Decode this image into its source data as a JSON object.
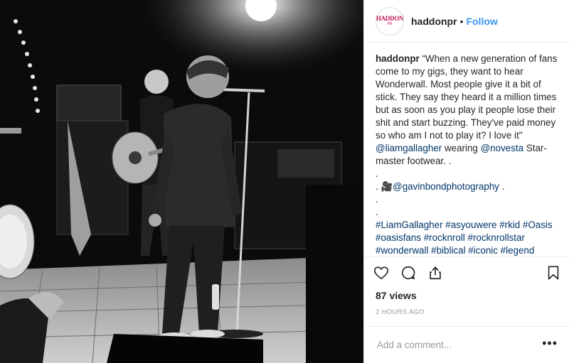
{
  "post": {
    "username": "haddonpr",
    "follow_label": "Follow",
    "separator": "•",
    "avatar_logo_main": "HADDON",
    "avatar_logo_sub": "PR",
    "caption": {
      "user": "haddonpr",
      "text_1": " “When a new generation of fans come to my gigs, they want to hear Wonderwall. Most people give it a bit of stick. They say they heard it a million times but as soon as you play it people lose their shit and start buzzing. They've paid money so who am I not to play it? I love it\" ",
      "mention_1": "@liamgallagher",
      "text_2": " wearing ",
      "mention_2": "@novesta",
      "text_3": " Star-master footwear. .\n.\n. 🎥",
      "mention_3": "@gavinbondphotography",
      "text_4": " .\n.\n.\n",
      "hashtags": "#LiamGallagher #asyouwere #rkid #Oasis #oasisfans #rocknroll #rocknrollstar #wonderwall #biblical #iconic #legend #liamgallagherdaily #novesta #haddonpr"
    },
    "views": "87 views",
    "timestamp": "2 HOURS AGO",
    "comment_placeholder": "Add a comment...",
    "more_label": "•••"
  },
  "icons": {
    "like": "heart-icon",
    "comment": "comment-icon",
    "share": "share-icon",
    "save": "bookmark-icon",
    "more": "more-options-icon"
  },
  "colors": {
    "link": "#003569",
    "follow": "#3897f0",
    "muted": "#999999",
    "brand": "#c2185b"
  }
}
